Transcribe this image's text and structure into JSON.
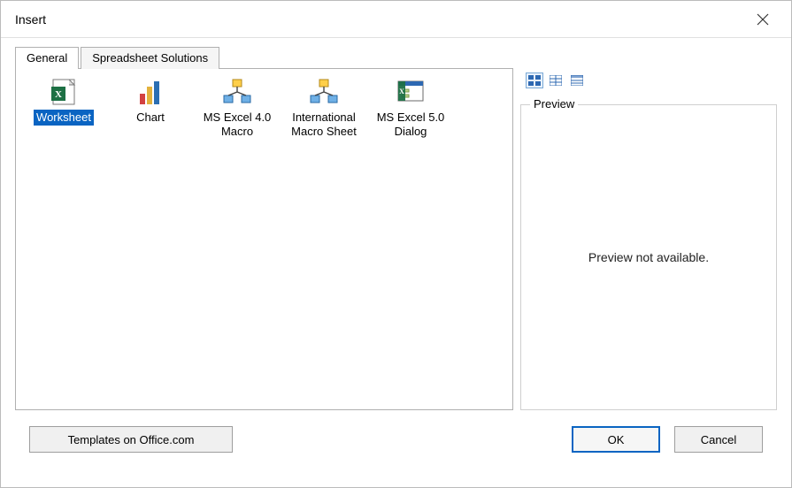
{
  "title": "Insert",
  "tabs": [
    {
      "label": "General",
      "active": true
    },
    {
      "label": "Spreadsheet Solutions",
      "active": false
    }
  ],
  "items": [
    {
      "name": "worksheet",
      "label": "Worksheet",
      "selected": true
    },
    {
      "name": "chart",
      "label": "Chart",
      "selected": false
    },
    {
      "name": "ms-excel-4-macro",
      "label": "MS Excel 4.0 Macro",
      "selected": false
    },
    {
      "name": "international-macro-sheet",
      "label": "International Macro Sheet",
      "selected": false
    },
    {
      "name": "ms-excel-5-dialog",
      "label": "MS Excel 5.0 Dialog",
      "selected": false
    }
  ],
  "view_buttons": [
    {
      "name": "large-icons",
      "active": true
    },
    {
      "name": "list-view",
      "active": false
    },
    {
      "name": "details-view",
      "active": false
    }
  ],
  "preview": {
    "legend": "Preview",
    "message": "Preview not available."
  },
  "buttons": {
    "templates": "Templates on Office.com",
    "ok": "OK",
    "cancel": "Cancel"
  }
}
